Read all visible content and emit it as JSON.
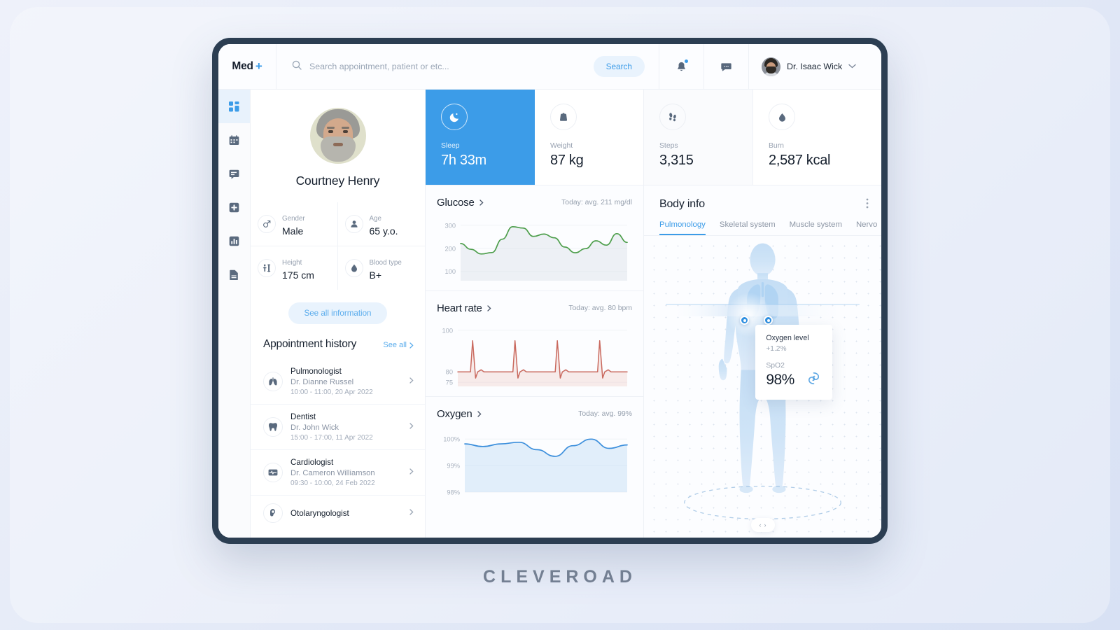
{
  "brand": {
    "name": "Med",
    "plus": "+"
  },
  "search": {
    "placeholder": "Search appointment, patient or etc...",
    "value": "",
    "button": "Search"
  },
  "user": {
    "name": "Dr. Isaac Wick",
    "chevron": "⌄"
  },
  "sidebar": {
    "items": [
      {
        "name": "dashboard",
        "active": true
      },
      {
        "name": "calendar",
        "active": false
      },
      {
        "name": "messages",
        "active": false
      },
      {
        "name": "add-record",
        "active": false
      },
      {
        "name": "statistics",
        "active": false
      },
      {
        "name": "documents",
        "active": false
      }
    ]
  },
  "patient": {
    "name": "Courtney Henry",
    "stats": [
      {
        "label": "Gender",
        "value": "Male",
        "icon": "gender-icon"
      },
      {
        "label": "Age",
        "value": "65 y.o.",
        "icon": "person-icon"
      },
      {
        "label": "Height",
        "value": "175 cm",
        "icon": "height-icon"
      },
      {
        "label": "Blood type",
        "value": "B+",
        "icon": "blood-drop-icon"
      }
    ],
    "see_all_button": "See all information"
  },
  "appointments": {
    "title": "Appointment history",
    "see_all": "See all",
    "items": [
      {
        "specialty": "Pulmonologist",
        "doctor": "Dr. Dianne Russel",
        "time": "10:00 - 11:00, 20 Apr 2022",
        "icon": "lungs-icon"
      },
      {
        "specialty": "Dentist",
        "doctor": "Dr. John Wick",
        "time": "15:00 - 17:00, 11 Apr 2022",
        "icon": "tooth-icon"
      },
      {
        "specialty": "Cardiologist",
        "doctor": "Dr. Cameron Williamson",
        "time": "09:30 - 10:00, 24 Feb 2022",
        "icon": "ecg-icon"
      },
      {
        "specialty": "Otolaryngologist",
        "doctor": "",
        "time": "",
        "icon": "ear-icon"
      }
    ]
  },
  "metrics": [
    {
      "label": "Sleep",
      "value": "7h 33m",
      "icon": "moon-icon",
      "active": true
    },
    {
      "label": "Weight",
      "value": "87 kg",
      "icon": "weight-icon",
      "active": false
    },
    {
      "label": "Steps",
      "value": "3,315",
      "icon": "footsteps-icon",
      "active": false
    },
    {
      "label": "Burn",
      "value": "2,587 kcal",
      "icon": "flame-icon",
      "active": false
    }
  ],
  "chart_data": [
    {
      "type": "area",
      "title": "Glucose",
      "subtitle": "Today: avg. 211 mg/dl",
      "ylabel": "mg/dl",
      "ylim": [
        60,
        330
      ],
      "yticks": [
        100,
        200,
        300
      ],
      "ytick_labels": [
        "100",
        "200",
        "300"
      ],
      "grid": true,
      "color": "#4d9e4b",
      "x": [
        0,
        1,
        2,
        3,
        4,
        5,
        6,
        7,
        8,
        9,
        10,
        11,
        12,
        13,
        14,
        15,
        16
      ],
      "values": [
        221,
        196,
        176,
        182,
        240,
        294,
        288,
        252,
        262,
        246,
        206,
        181,
        199,
        233,
        214,
        264,
        226
      ]
    },
    {
      "type": "line",
      "title": "Heart rate",
      "subtitle": "Today: avg. 80 bpm",
      "ylabel": "bpm",
      "ylim": [
        73,
        103
      ],
      "yticks": [
        75,
        80,
        100
      ],
      "ytick_labels": [
        "75",
        "80",
        "100"
      ],
      "grid": true,
      "color": "#c9695e",
      "waveform": "ecg",
      "beats": 4,
      "baseline": 80,
      "peak": 95,
      "trough": 77,
      "bump": 81
    },
    {
      "type": "area",
      "title": "Oxygen",
      "subtitle": "Today: avg. 99%",
      "ylabel": "%",
      "ylim": [
        98,
        100.35
      ],
      "yticks": [
        98,
        99,
        100
      ],
      "ytick_labels": [
        "98%",
        "99%",
        "100%"
      ],
      "grid": true,
      "color": "#3c8fdc",
      "x": [
        0,
        1,
        2,
        3,
        4,
        5,
        6,
        7,
        8
      ],
      "values": [
        99.82,
        99.72,
        99.82,
        99.88,
        99.6,
        99.35,
        99.75,
        100.0,
        99.65,
        99.78
      ]
    }
  ],
  "body_info": {
    "title": "Body info",
    "menu_icon": "kebab-menu-icon",
    "tabs": [
      {
        "label": "Pulmonology",
        "active": true
      },
      {
        "label": "Skeletal system",
        "active": false
      },
      {
        "label": "Muscle system",
        "active": false
      },
      {
        "label": "Nervo",
        "active": false
      }
    ],
    "tooltip": {
      "label": "Oxygen level",
      "delta": "+1.2%",
      "metric_label": "SpO2",
      "metric_value": "98%",
      "icon": "oxygen-swirl-icon"
    },
    "rotate_prev": "‹",
    "rotate_next": "›"
  },
  "watermark": "CLEVEROAD",
  "colors": {
    "accent": "#3c9ce8",
    "accent_soft": "#e9f3fd",
    "frame": "#2c3e52",
    "glucose": "#4d9e4b",
    "heart": "#c9695e",
    "oxygen": "#3c8fdc",
    "text": "#16202e",
    "muted": "#96a0ae"
  }
}
